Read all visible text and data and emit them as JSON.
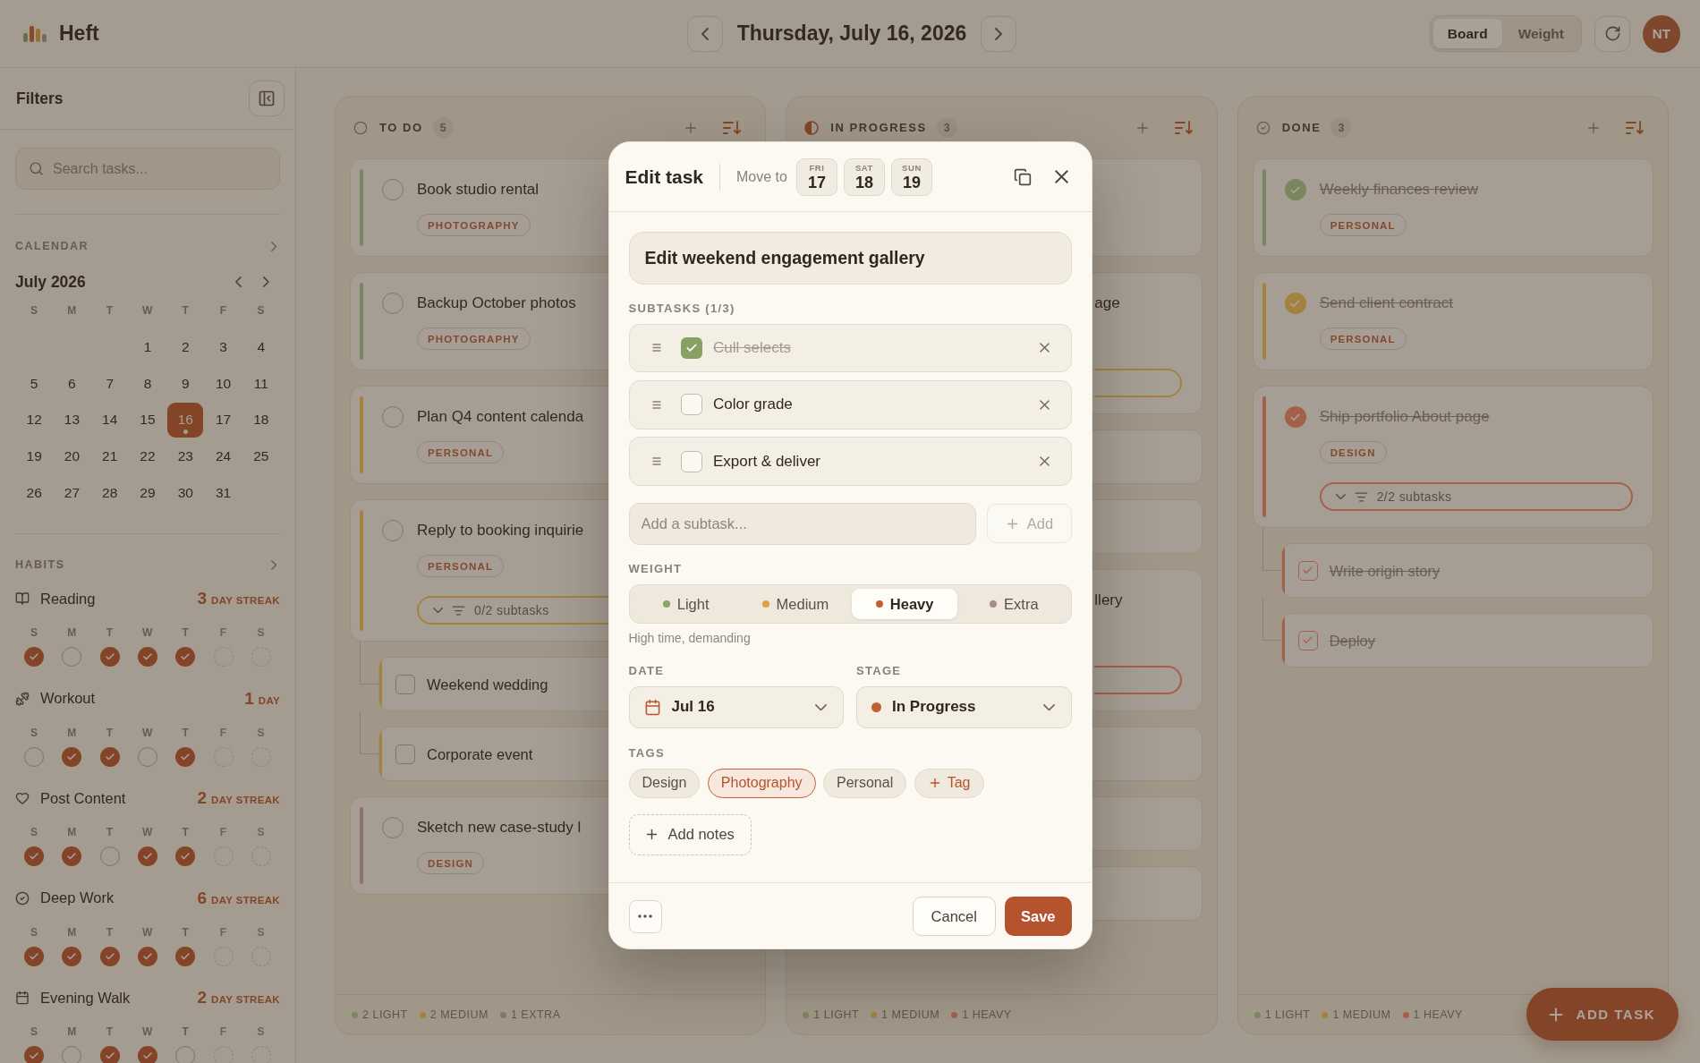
{
  "app": {
    "name": "Heft"
  },
  "header": {
    "date": "Thursday, July 16, 2026",
    "views": [
      {
        "label": "Board",
        "selected": true
      },
      {
        "label": "Weight",
        "selected": false
      }
    ],
    "avatar": "NT"
  },
  "sidebar": {
    "title": "Filters",
    "search": {
      "placeholder": "Search tasks..."
    },
    "calendar": {
      "label": "CALENDAR",
      "month": "July 2026",
      "weekdays": [
        "S",
        "M",
        "T",
        "W",
        "T",
        "F",
        "S"
      ],
      "weeks": [
        [
          {
            "label": "1",
            "selected": false,
            "has_tasks": false
          },
          {
            "label": "2",
            "selected": false,
            "has_tasks": false
          },
          {
            "label": "3",
            "selected": false,
            "has_tasks": false
          },
          {
            "label": "4",
            "selected": false,
            "has_tasks": false
          }
        ],
        [
          {
            "label": "5",
            "selected": false,
            "has_tasks": false
          },
          {
            "label": "6",
            "selected": false,
            "has_tasks": false
          },
          {
            "label": "7",
            "selected": false,
            "has_tasks": false
          },
          {
            "label": "8",
            "selected": false,
            "has_tasks": false
          },
          {
            "label": "9",
            "selected": false,
            "has_tasks": false
          },
          {
            "label": "10",
            "selected": false,
            "has_tasks": false
          },
          {
            "label": "11",
            "selected": false,
            "has_tasks": false
          }
        ],
        [
          {
            "label": "12",
            "selected": false,
            "has_tasks": false
          },
          {
            "label": "13",
            "selected": false,
            "has_tasks": false
          },
          {
            "label": "14",
            "selected": false,
            "has_tasks": false
          },
          {
            "label": "15",
            "selected": false,
            "has_tasks": false
          },
          {
            "label": "16",
            "selected": true,
            "has_tasks": true
          },
          {
            "label": "17",
            "selected": false,
            "has_tasks": false
          },
          {
            "label": "18",
            "selected": false,
            "has_tasks": false
          }
        ],
        [
          {
            "label": "19",
            "selected": false,
            "has_tasks": false
          },
          {
            "label": "20",
            "selected": false,
            "has_tasks": false
          },
          {
            "label": "21",
            "selected": false,
            "has_tasks": false
          },
          {
            "label": "22",
            "selected": false,
            "has_tasks": false
          },
          {
            "label": "23",
            "selected": false,
            "has_tasks": false
          },
          {
            "label": "24",
            "selected": false,
            "has_tasks": false
          },
          {
            "label": "25",
            "selected": false,
            "has_tasks": false
          }
        ],
        [
          {
            "label": "26",
            "selected": false,
            "has_tasks": false
          },
          {
            "label": "27",
            "selected": false,
            "has_tasks": false
          },
          {
            "label": "28",
            "selected": false,
            "has_tasks": false
          },
          {
            "label": "29",
            "selected": false,
            "has_tasks": false
          },
          {
            "label": "30",
            "selected": false,
            "has_tasks": false
          },
          {
            "label": "31",
            "selected": false,
            "has_tasks": false
          }
        ]
      ]
    },
    "habits": {
      "label": "HABITS",
      "items": [
        {
          "name": "Reading",
          "streak": "3",
          "streak_unit": "DAY STREAK",
          "days": [
            {
              "label": "S",
              "checked": true,
              "upcoming": false
            },
            {
              "label": "M",
              "checked": false,
              "upcoming": false
            },
            {
              "label": "T",
              "checked": true,
              "upcoming": false
            },
            {
              "label": "W",
              "checked": true,
              "upcoming": false
            },
            {
              "label": "T",
              "checked": true,
              "upcoming": false
            },
            {
              "label": "F",
              "checked": false,
              "upcoming": true
            },
            {
              "label": "S",
              "checked": false,
              "upcoming": true
            }
          ]
        },
        {
          "name": "Workout",
          "streak": "1",
          "streak_unit": "DAY",
          "days": [
            {
              "label": "S",
              "checked": false,
              "upcoming": false
            },
            {
              "label": "M",
              "checked": true,
              "upcoming": false
            },
            {
              "label": "T",
              "checked": true,
              "upcoming": false
            },
            {
              "label": "W",
              "checked": false,
              "upcoming": false
            },
            {
              "label": "T",
              "checked": true,
              "upcoming": false
            },
            {
              "label": "F",
              "checked": false,
              "upcoming": true
            },
            {
              "label": "S",
              "checked": false,
              "upcoming": true
            }
          ]
        },
        {
          "name": "Post Content",
          "streak": "2",
          "streak_unit": "DAY STREAK",
          "days": [
            {
              "label": "S",
              "checked": true,
              "upcoming": false
            },
            {
              "label": "M",
              "checked": true,
              "upcoming": false
            },
            {
              "label": "T",
              "checked": false,
              "upcoming": false
            },
            {
              "label": "W",
              "checked": true,
              "upcoming": false
            },
            {
              "label": "T",
              "checked": true,
              "upcoming": false
            },
            {
              "label": "F",
              "checked": false,
              "upcoming": true
            },
            {
              "label": "S",
              "checked": false,
              "upcoming": true
            }
          ]
        },
        {
          "name": "Deep Work",
          "streak": "6",
          "streak_unit": "DAY STREAK",
          "days": [
            {
              "label": "S",
              "checked": true,
              "upcoming": false
            },
            {
              "label": "M",
              "checked": true,
              "upcoming": false
            },
            {
              "label": "T",
              "checked": true,
              "upcoming": false
            },
            {
              "label": "W",
              "checked": true,
              "upcoming": false
            },
            {
              "label": "T",
              "checked": true,
              "upcoming": false
            },
            {
              "label": "F",
              "checked": false,
              "upcoming": true
            },
            {
              "label": "S",
              "checked": false,
              "upcoming": true
            }
          ]
        },
        {
          "name": "Evening Walk",
          "streak": "2",
          "streak_unit": "DAY STREAK",
          "days": [
            {
              "label": "S",
              "checked": true,
              "upcoming": false
            },
            {
              "label": "M",
              "checked": false,
              "upcoming": false
            },
            {
              "label": "T",
              "checked": true,
              "upcoming": false
            },
            {
              "label": "W",
              "checked": true,
              "upcoming": false
            },
            {
              "label": "T",
              "checked": false,
              "upcoming": false
            },
            {
              "label": "F",
              "checked": false,
              "upcoming": true
            },
            {
              "label": "S",
              "checked": false,
              "upcoming": true
            }
          ]
        }
      ]
    }
  },
  "columns": [
    {
      "kind": "todo",
      "title": "TO DO",
      "count": "5",
      "cards": [
        {
          "kind": "task",
          "title": "Book studio rental",
          "tag": "PHOTOGRAPHY",
          "color": "#7b865e",
          "done": false
        },
        {
          "kind": "task",
          "title": "Backup October photos",
          "tag": "PHOTOGRAPHY",
          "color": "#7b865e",
          "done": false
        },
        {
          "kind": "task",
          "title": "Plan Q4 content calenda",
          "tag": "PERSONAL",
          "color": "#a4823f",
          "done": false
        },
        {
          "kind": "task",
          "title": "Reply to booking inquirie",
          "tag": "PERSONAL",
          "color": "#a4823f",
          "done": false,
          "subtasks": {
            "label": "0/2 subtasks",
            "expanded": true
          }
        },
        {
          "kind": "subtask",
          "title": "Weekend wedding",
          "color": "#a4823f",
          "done": false
        },
        {
          "kind": "subtask",
          "title": "Corporate event",
          "color": "#a4823f",
          "done": false
        },
        {
          "kind": "task",
          "title": "Sketch new case-study l",
          "tag": "DESIGN",
          "color": "#8c726f",
          "done": false
        }
      ],
      "footer": [
        {
          "label": "2 LIGHT",
          "color": "#7b865e"
        },
        {
          "label": "2 MEDIUM",
          "color": "#a4823f"
        },
        {
          "label": "1 EXTRA",
          "color": "#8c726f"
        }
      ]
    },
    {
      "kind": "progress",
      "title": "IN PROGRESS",
      "count": "3",
      "cards": [
        {
          "kind": "covered_task",
          "has_subtasks": false
        },
        {
          "kind": "covered_task",
          "title": "age",
          "color": "#a4823f",
          "has_subtasks": true
        },
        {
          "kind": "covered_subtask"
        },
        {
          "kind": "covered_subtask"
        },
        {
          "kind": "covered_task",
          "title": "llery",
          "color": "#a5604a",
          "has_subtasks": true
        },
        {
          "kind": "covered_subtask"
        },
        {
          "kind": "covered_subtask"
        },
        {
          "kind": "covered_subtask"
        }
      ],
      "footer": [
        {
          "label": "1 LIGHT",
          "color": "#7b865e"
        },
        {
          "label": "1 MEDIUM",
          "color": "#a4823f"
        },
        {
          "label": "1 HEAVY",
          "color": "#a5604a"
        }
      ]
    },
    {
      "kind": "done",
      "title": "DONE",
      "count": "3",
      "cards": [
        {
          "kind": "task",
          "title": "Weekly finances review",
          "tag": "PERSONAL",
          "color": "#7b865e",
          "done": true
        },
        {
          "kind": "task",
          "title": "Send client contract",
          "tag": "PERSONAL",
          "color": "#a4823f",
          "done": true
        },
        {
          "kind": "task",
          "title": "Ship portfolio About page",
          "tag": "DESIGN",
          "color": "#a5604a",
          "done": true,
          "subtasks": {
            "label": "2/2 subtasks",
            "expanded": true
          }
        },
        {
          "kind": "subtask",
          "title": "Write origin story",
          "color": "#a5604a",
          "done": true
        },
        {
          "kind": "subtask",
          "title": "Deploy",
          "color": "#a5604a",
          "done": true
        }
      ],
      "footer": [
        {
          "label": "1 LIGHT",
          "color": "#7b865e"
        },
        {
          "label": "1 MEDIUM",
          "color": "#a4823f"
        },
        {
          "label": "1 HEAVY",
          "color": "#a5604a"
        }
      ]
    }
  ],
  "fab": {
    "label": "ADD TASK"
  },
  "modal": {
    "title": "Edit task",
    "move_label": "Move to",
    "move_days": [
      {
        "weekday": "FRI",
        "day": "17"
      },
      {
        "weekday": "SAT",
        "day": "18"
      },
      {
        "weekday": "SUN",
        "day": "19"
      }
    ],
    "task_title": "Edit weekend engagement gallery",
    "subtasks_label": "SUBTASKS (1/3)",
    "subtasks": [
      {
        "title": "Cull selects",
        "done": true
      },
      {
        "title": "Color grade",
        "done": false
      },
      {
        "title": "Export & deliver",
        "done": false
      }
    ],
    "add_subtask": {
      "placeholder": "Add a subtask...",
      "button": "Add",
      "disabled": true
    },
    "weight_label": "WEIGHT",
    "weights": [
      {
        "label": "Light",
        "color": "#8aa46c",
        "selected": false
      },
      {
        "label": "Medium",
        "color": "#d9a445",
        "selected": false
      },
      {
        "label": "Heavy",
        "color": "#c45f34",
        "selected": true
      },
      {
        "label": "Extra",
        "color": "#a88a8c",
        "selected": false
      }
    ],
    "weight_hint": "High time, demanding",
    "date": {
      "label": "DATE",
      "value": "Jul 16"
    },
    "stage": {
      "label": "STAGE",
      "value": "In Progress",
      "color": "#c45f34"
    },
    "tags_label": "TAGS",
    "tags": [
      {
        "label": "Design",
        "selected": false
      },
      {
        "label": "Photography",
        "selected": true
      },
      {
        "label": "Personal",
        "selected": false
      }
    ],
    "add_tag": "Tag",
    "add_notes": "Add notes",
    "cancel": "Cancel",
    "save": "Save"
  }
}
